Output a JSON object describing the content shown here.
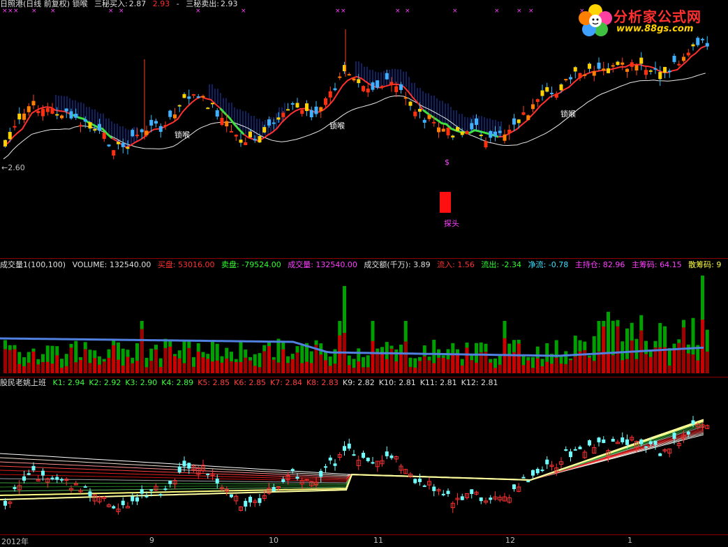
{
  "header1": {
    "title": "日照港(日线 前复权) 锁喉",
    "buy_label": "三秘买入:",
    "buy_value": "2.87",
    "mid_value": "2.93",
    "dash": "-",
    "sell_label": "三秘卖出:",
    "sell_value": "2.93"
  },
  "header2": {
    "name": "成交量1(100,100)",
    "volume": "VOLUME: 132540.00",
    "buy": "买盘: 53016.00",
    "sell": "卖盘: -79524.00",
    "vol": "成交量: 132540.00",
    "amount": "成交额(千万): 3.89",
    "inflow": "流入: 1.56",
    "outflow": "流出: -2.34",
    "net": "净流: -0.78",
    "main_hold": "主持仓: 82.96",
    "main_chips": "主筹码: 64.15",
    "retail_chips": "散筹码: 9"
  },
  "header3": {
    "name": "股民老姚上班",
    "k_values": [
      "K1: 2.94",
      "K2: 2.92",
      "K3: 2.90",
      "K4: 2.89",
      "K5: 2.85",
      "K6: 2.85",
      "K7: 2.84",
      "K8: 2.83",
      "K9: 2.82",
      "K10: 2.81",
      "K11: 2.81",
      "K12: 2.81"
    ]
  },
  "annotations": {
    "lock_label": "锁喉",
    "probe_label": "探头",
    "low_marker": "←2.60",
    "dollar": "$"
  },
  "logo": {
    "title": "分析家公式网",
    "url": "www.88gs.com"
  },
  "x_axis_labels": [
    "2012年",
    "9",
    "10",
    "11",
    "12",
    "1"
  ],
  "colors": {
    "up": "#ff2020",
    "down": "#00c0c0",
    "volume_up": "#cc0000",
    "volume_down": "#00a000",
    "ma_volume": "#4a7ee0"
  },
  "chart_data": [
    {
      "type": "candlestick",
      "panel": "price",
      "last_low_marker": 2.6,
      "series": [
        {
          "name": "三秘买入",
          "value": 2.87
        },
        {
          "name": "三秘卖出",
          "value": 2.93
        }
      ]
    },
    {
      "type": "bar",
      "panel": "volume",
      "series": [
        {
          "name": "VOLUME",
          "value": 132540.0
        },
        {
          "name": "买盘",
          "value": 53016.0
        },
        {
          "name": "卖盘",
          "value": -79524.0
        }
      ]
    },
    {
      "type": "line",
      "panel": "indicator",
      "series": [
        {
          "name": "K1",
          "value": 2.94
        },
        {
          "name": "K2",
          "value": 2.92
        },
        {
          "name": "K3",
          "value": 2.9
        },
        {
          "name": "K4",
          "value": 2.89
        },
        {
          "name": "K5",
          "value": 2.85
        },
        {
          "name": "K6",
          "value": 2.85
        },
        {
          "name": "K7",
          "value": 2.84
        },
        {
          "name": "K8",
          "value": 2.83
        },
        {
          "name": "K9",
          "value": 2.82
        },
        {
          "name": "K10",
          "value": 2.81
        },
        {
          "name": "K11",
          "value": 2.81
        },
        {
          "name": "K12",
          "value": 2.81
        }
      ]
    }
  ]
}
